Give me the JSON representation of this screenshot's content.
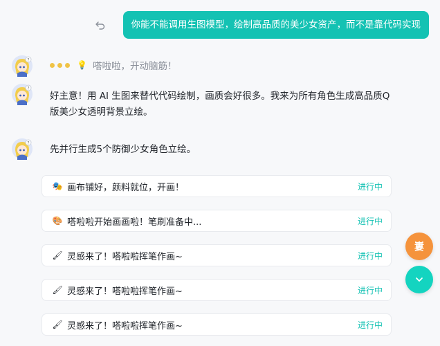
{
  "user_message": "你能不能调用生图模型，绘制高品质的美少女资产，而不是靠代码实现",
  "thinking": "嗒啦啦，开动脑筋！",
  "reply_1": "好主意！用 AI 生图来替代代码绘制，画质会好很多。我来为所有角色生成高品质Q版美少女透明背景立绘。",
  "reply_2": "先并行生成5个防御少女角色立绘。",
  "tasks": [
    {
      "icon": "theater-masks-icon",
      "glyph": "🎭",
      "label": "画布铺好，颜料就位，开画！",
      "status": "进行中"
    },
    {
      "icon": "palette-icon",
      "glyph": "🎨",
      "label": "嗒啦啦开始画画啦！笔刷准备中...",
      "status": "进行中"
    },
    {
      "icon": "paintbrush-icon",
      "glyph": "🖌",
      "label": "灵感来了！嗒啦啦挥笔作画~",
      "status": "进行中"
    },
    {
      "icon": "paintbrush-icon",
      "glyph": "🖌",
      "label": "灵感来了！嗒啦啦挥笔作画~",
      "status": "进行中"
    },
    {
      "icon": "paintbrush-icon",
      "glyph": "🖌",
      "label": "灵感来了！嗒啦啦挥笔作画~",
      "status": "进行中"
    }
  ],
  "fab_bug_label": "㟺",
  "colors": {
    "accent": "#14c2b3",
    "bug_button": "#f5933c",
    "thinking_dots": "#f0c346"
  }
}
